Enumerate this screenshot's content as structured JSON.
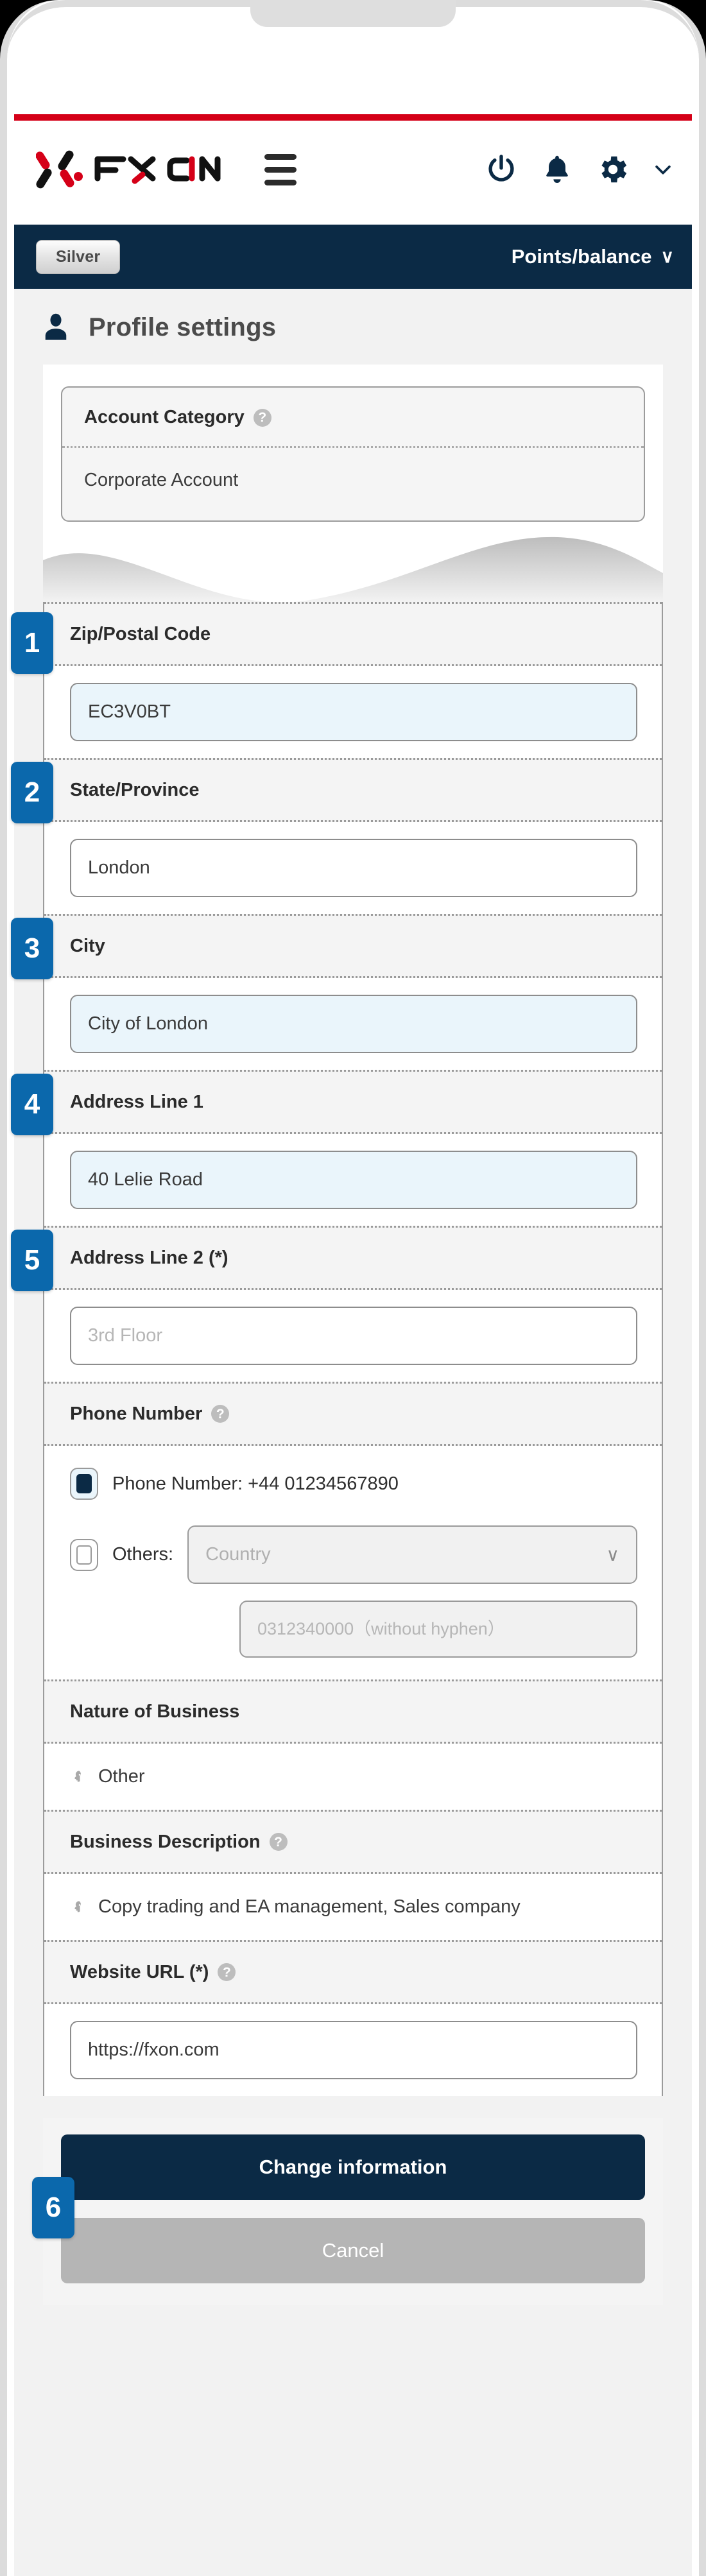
{
  "header": {
    "logo_text": "FXON",
    "menu_icon": "hamburger-menu-icon",
    "power_icon": "power-icon",
    "bell_icon": "bell-icon",
    "gear_icon": "gear-icon",
    "chevron_icon": "chevron-down-icon"
  },
  "status_strip": {
    "tier_badge": "Silver",
    "points_label": "Points/balance",
    "points_chevron": "∨"
  },
  "page": {
    "title": "Profile settings",
    "avatar_icon": "user-avatar-icon"
  },
  "account_category": {
    "label": "Account Category",
    "help": "?",
    "value": "Corporate Account"
  },
  "fields": [
    {
      "step": "1",
      "label": "Zip/Postal Code",
      "value": "EC3V0BT",
      "placeholder": "",
      "highlighted": true
    },
    {
      "step": "2",
      "label": "State/Province",
      "value": "London",
      "placeholder": "",
      "highlighted": false
    },
    {
      "step": "3",
      "label": "City",
      "value": "City of London",
      "placeholder": "",
      "highlighted": true
    },
    {
      "step": "4",
      "label": "Address Line 1",
      "value": "40 Lelie Road",
      "placeholder": "",
      "highlighted": true
    },
    {
      "step": "5",
      "label": "Address Line 2 (*)",
      "value": "",
      "placeholder": "3rd Floor",
      "highlighted": false
    }
  ],
  "phone_section": {
    "label": "Phone Number",
    "help": "?",
    "primary_option": "Phone Number: +44 01234567890",
    "others_option": "Others:",
    "country_placeholder": "Country",
    "country_chevron": "∨",
    "number_placeholder": "0312340000（without hyphen）"
  },
  "nature_of_business": {
    "label": "Nature of Business",
    "value": "Other",
    "lock_icon": "key-icon"
  },
  "business_description": {
    "label": "Business Description",
    "help": "?",
    "value": "Copy trading and EA management, Sales company",
    "lock_icon": "key-icon"
  },
  "website_url": {
    "label": "Website URL (*)",
    "help": "?",
    "value": "https://fxon.com",
    "placeholder": ""
  },
  "actions": {
    "step": "6",
    "submit_label": "Change information",
    "cancel_label": "Cancel"
  },
  "colors": {
    "brand_red": "#d50018",
    "navy": "#0b2a45",
    "step_blue": "#0b68ac",
    "highlight_blue": "#eaf5fb"
  }
}
